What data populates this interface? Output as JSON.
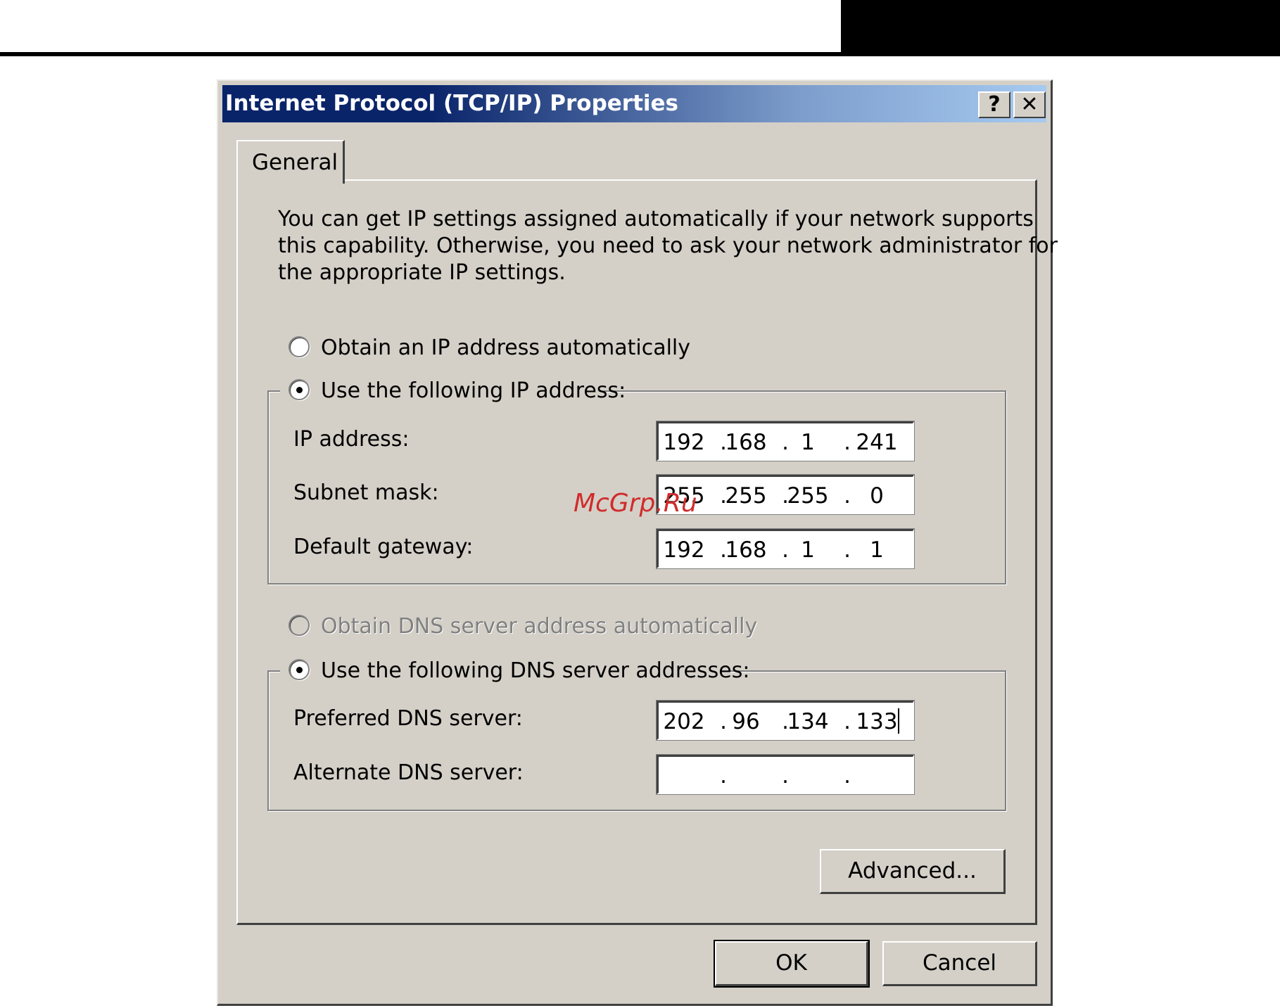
{
  "dialog": {
    "title": "Internet Protocol (TCP/IP) Properties",
    "help_label": "?",
    "close_label": "✕"
  },
  "tabs": [
    {
      "label": "General"
    }
  ],
  "intro": {
    "line1": "You can get IP settings assigned automatically if your network supports",
    "line2": "this capability. Otherwise, you need to ask your network administrator for",
    "line3": "the appropriate IP settings."
  },
  "ip_mode": {
    "auto_label": "Obtain an IP address automatically",
    "manual_label": "Use the following IP address:",
    "selected": "manual"
  },
  "ip_fields": {
    "ip_address": {
      "label": "IP address:",
      "octets": [
        "192",
        "168",
        "1",
        "241"
      ]
    },
    "subnet_mask": {
      "label": "Subnet mask:",
      "octets": [
        "255",
        "255",
        "255",
        "0"
      ]
    },
    "default_gateway": {
      "label": "Default gateway:",
      "octets": [
        "192",
        "168",
        "1",
        "1"
      ]
    }
  },
  "dns_mode": {
    "auto_label": "Obtain DNS server address automatically",
    "manual_label": "Use the following DNS server addresses:",
    "selected": "manual",
    "auto_disabled": true
  },
  "dns_fields": {
    "preferred": {
      "label": "Preferred DNS server:",
      "octets": [
        "202",
        "96",
        "134",
        "133"
      ]
    },
    "alternate": {
      "label": "Alternate DNS server:",
      "octets": [
        "",
        "",
        "",
        ""
      ]
    }
  },
  "buttons": {
    "advanced": "Advanced...",
    "ok": "OK",
    "cancel": "Cancel"
  },
  "watermark": "McGrp.Ru",
  "colors": {
    "title_gradient_start": "#0a246a",
    "title_gradient_end": "#a6caf0",
    "dialog_face": "#d4d0c8",
    "watermark": "#d02c2c"
  }
}
